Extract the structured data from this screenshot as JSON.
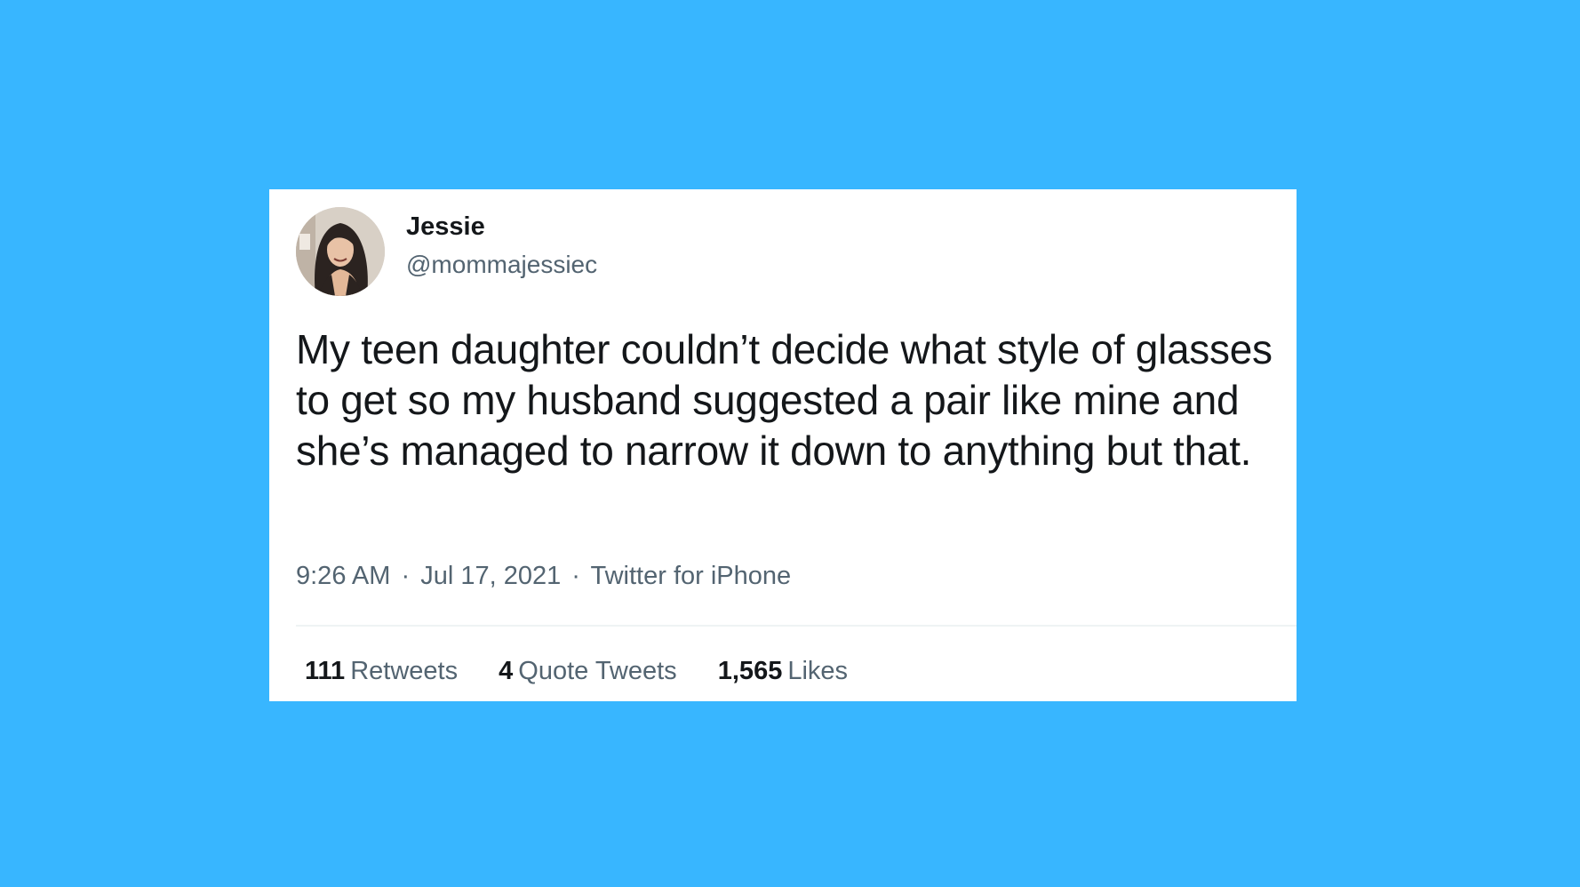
{
  "tweet": {
    "author": {
      "name": "Jessie",
      "handle": "@mommajessiec",
      "avatar_icon": "profile-photo"
    },
    "text": "My teen daughter couldn’t decide what style of glasses to get so my husband suggested a pair like mine and she’s managed to narrow it down to anything but that.",
    "time": "9:26 AM",
    "date": "Jul 17, 2021",
    "source": "Twitter for iPhone",
    "separator": "·",
    "stats": {
      "retweets": {
        "count": "111",
        "label": "Retweets"
      },
      "quote_tweets": {
        "count": "4",
        "label": "Quote Tweets"
      },
      "likes": {
        "count": "1,565",
        "label": "Likes"
      }
    }
  },
  "colors": {
    "background": "#38b6ff",
    "card": "#ffffff",
    "text_primary": "#14171a",
    "text_secondary": "#536471"
  }
}
